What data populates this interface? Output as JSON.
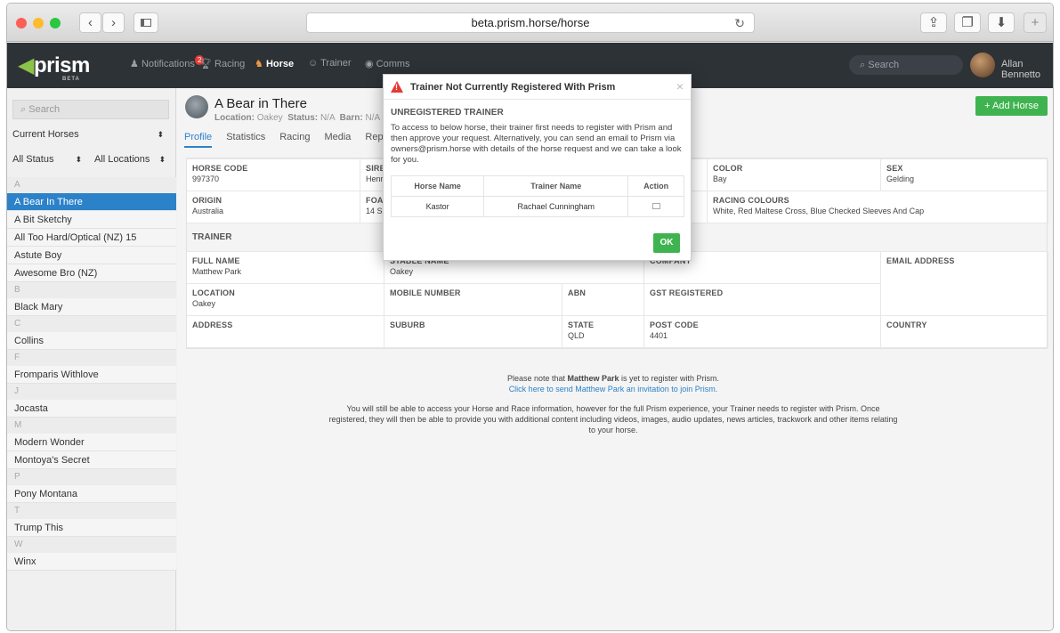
{
  "browser": {
    "url": "beta.prism.horse/horse",
    "back_label": "‹",
    "forward_label": "›"
  },
  "appnav": {
    "logo": "prism",
    "logo_beta": "BETA",
    "items": [
      {
        "label": "Notifications",
        "badge": "2",
        "icon": "bell-icon"
      },
      {
        "label": "Racing",
        "icon": "trophy-icon"
      },
      {
        "label": "Horse",
        "icon": "horse-icon",
        "active": true
      },
      {
        "label": "Trainer",
        "icon": "person-icon"
      },
      {
        "label": "Comms",
        "icon": "chat-icon"
      }
    ],
    "search_placeholder": "Search",
    "user_name": "Allan Bennetto"
  },
  "sidebar": {
    "search_placeholder": "Search",
    "filter_current": "Current Horses",
    "filter_status": "All Status",
    "filter_location": "All Locations",
    "groups": [
      {
        "letter": "A",
        "items": [
          "A Bear In There",
          "A Bit Sketchy",
          "All Too Hard/Optical (NZ) 15",
          "Astute Boy",
          "Awesome Bro (NZ)"
        ]
      },
      {
        "letter": "B",
        "items": [
          "Black Mary"
        ]
      },
      {
        "letter": "C",
        "items": [
          "Collins"
        ]
      },
      {
        "letter": "F",
        "items": [
          "Fromparis Withlove"
        ]
      },
      {
        "letter": "J",
        "items": [
          "Jocasta"
        ]
      },
      {
        "letter": "M",
        "items": [
          "Modern Wonder",
          "Montoya's Secret"
        ]
      },
      {
        "letter": "P",
        "items": [
          "Pony Montana"
        ]
      },
      {
        "letter": "T",
        "items": [
          "Trump This"
        ]
      },
      {
        "letter": "W",
        "items": [
          "Winx"
        ]
      }
    ]
  },
  "horse": {
    "name": "A Bear in There",
    "location_label": "Location:",
    "location": "Oakey",
    "status_label": "Status:",
    "status": "N/A",
    "barn_label": "Barn:",
    "barn": "N/A",
    "tabs": [
      "Profile",
      "Statistics",
      "Racing",
      "Media",
      "Repo"
    ],
    "add_horse": "+ Add Horse",
    "details_row1": [
      {
        "label": "HORSE CODE",
        "value": "997370"
      },
      {
        "label": "SIRE",
        "value": "Henr"
      },
      {
        "label": "",
        "value": ""
      },
      {
        "label": "COLOR",
        "value": "Bay"
      },
      {
        "label": "SEX",
        "value": "Gelding"
      }
    ],
    "details_row2": [
      {
        "label": "ORIGIN",
        "value": "Australia"
      },
      {
        "label": "FOAL",
        "value": "14 Se"
      },
      {
        "label": "",
        "value": ""
      },
      {
        "label": "RACING COLOURS",
        "value": "White, Red Maltese Cross, Blue Checked Sleeves And Cap"
      }
    ]
  },
  "trainer": {
    "section": "TRAINER",
    "full_name_label": "FULL NAME",
    "full_name": "Matthew Park",
    "stable_name_label": "STABLE NAME",
    "stable_name": "Oakey",
    "company_label": "COMPANY",
    "email_label": "EMAIL ADDRESS",
    "location_label": "LOCATION",
    "location": "Oakey",
    "mobile_label": "MOBILE NUMBER",
    "abn_label": "ABN",
    "gst_label": "GST REGISTERED",
    "address_label": "ADDRESS",
    "suburb_label": "SUBURB",
    "state_label": "STATE",
    "state": "QLD",
    "postcode_label": "POST CODE",
    "postcode": "4401",
    "country_label": "COUNTRY"
  },
  "note": {
    "line1_pre": "Please note that ",
    "line1_name": "Matthew Park",
    "line1_post": " is yet to register with Prism.",
    "line2": "Click here to send Matthew Park an invitation to join Prism.",
    "line3": "You will still be able to access your Horse and Race information, however for the full Prism experience, your Trainer needs to register with Prism. Once registered, they will then be able to provide you with additional content including videos, images, audio updates, news articles, trackwork and other items relating to your horse."
  },
  "modal": {
    "title": "Trainer Not Currently Registered With Prism",
    "subtitle": "UNREGISTERED TRAINER",
    "body": "To access to below horse, their trainer first needs to register with Prism and then approve your request. Alternatively, you can send an email to Prism via owners@prism.horse with details of the horse request and we can take a look for you.",
    "columns": [
      "Horse Name",
      "Trainer Name",
      "Action"
    ],
    "row": {
      "horse": "Kastor",
      "trainer": "Rachael Cunningham"
    },
    "ok": "OK",
    "close": "×"
  }
}
